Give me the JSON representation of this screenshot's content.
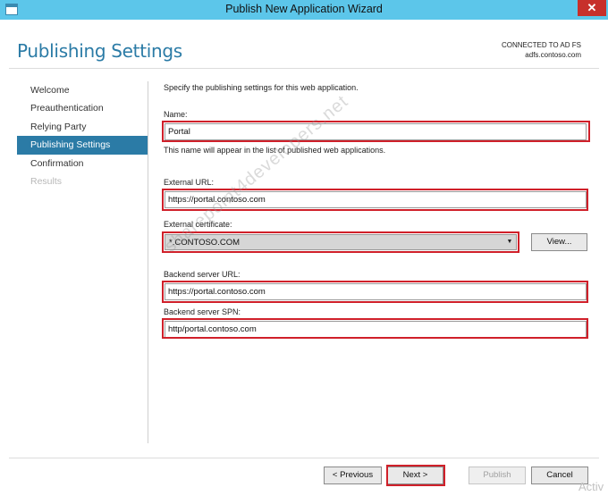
{
  "window": {
    "title": "Publish New Application Wizard",
    "close_glyph": "✕",
    "icon": "application-icon"
  },
  "header": {
    "page_title": "Publishing Settings",
    "connection_label": "CONNECTED TO AD FS",
    "connection_host": "adfs.contoso.com"
  },
  "steps": [
    {
      "label": "Welcome",
      "state": "normal"
    },
    {
      "label": "Preauthentication",
      "state": "normal"
    },
    {
      "label": "Relying Party",
      "state": "normal"
    },
    {
      "label": "Publishing Settings",
      "state": "active"
    },
    {
      "label": "Confirmation",
      "state": "normal"
    },
    {
      "label": "Results",
      "state": "disabled"
    }
  ],
  "form": {
    "intro": "Specify the publishing settings for this web application.",
    "name_label": "Name:",
    "name_value": "Portal",
    "name_hint": "This name will appear in the list of published web applications.",
    "external_url_label": "External URL:",
    "external_url_value": "https://portal.contoso.com",
    "external_cert_label": "External certificate:",
    "external_cert_value": "*.CONTOSO.COM",
    "view_button": "View...",
    "backend_url_label": "Backend server URL:",
    "backend_url_value": "https://portal.contoso.com",
    "backend_spn_label": "Backend server SPN:",
    "backend_spn_value": "http/portal.contoso.com"
  },
  "footer": {
    "previous": "< Previous",
    "next": "Next >",
    "publish": "Publish",
    "cancel": "Cancel"
  },
  "overlays": {
    "watermark": "sharepoint4developers.net",
    "activate": "Activ"
  },
  "colors": {
    "accent": "#2b7ba6",
    "titlebar": "#5cc6ea",
    "highlight": "#d0202a",
    "close": "#c7302b"
  }
}
